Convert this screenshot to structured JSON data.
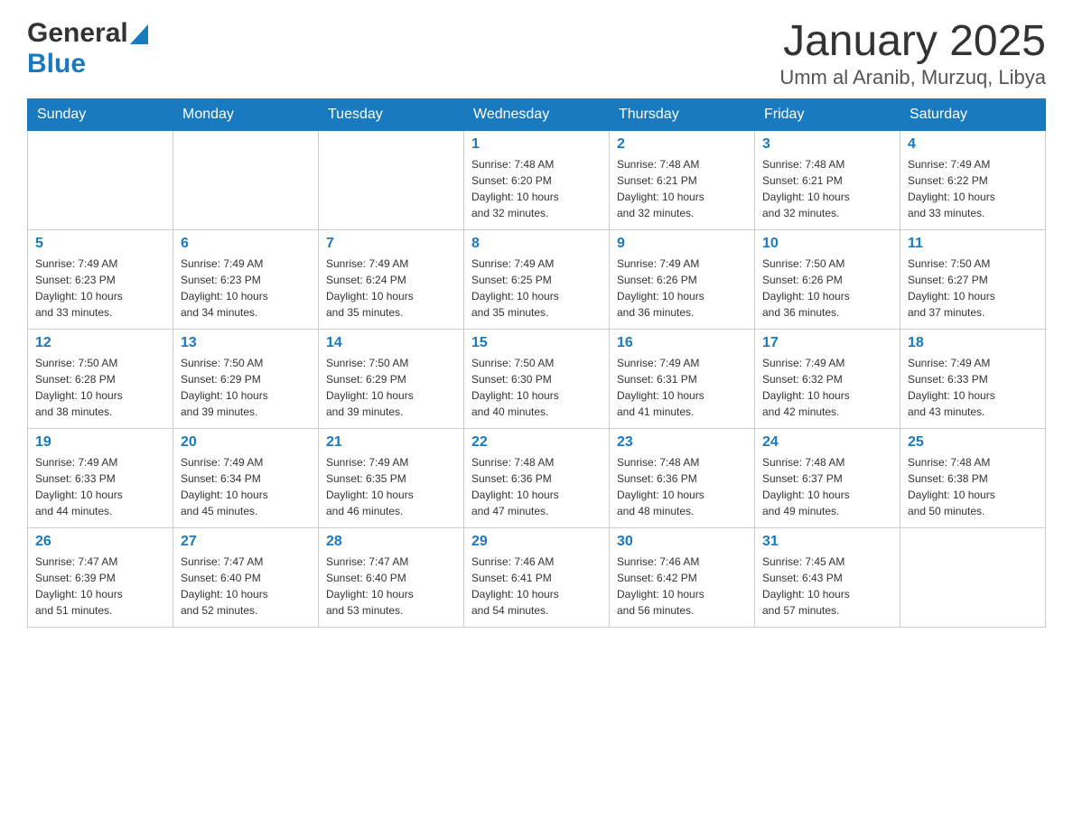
{
  "header": {
    "logo_general": "General",
    "logo_blue": "Blue",
    "month_title": "January 2025",
    "location": "Umm al Aranib, Murzuq, Libya"
  },
  "days_of_week": [
    "Sunday",
    "Monday",
    "Tuesday",
    "Wednesday",
    "Thursday",
    "Friday",
    "Saturday"
  ],
  "weeks": [
    [
      {
        "day": "",
        "info": ""
      },
      {
        "day": "",
        "info": ""
      },
      {
        "day": "",
        "info": ""
      },
      {
        "day": "1",
        "info": "Sunrise: 7:48 AM\nSunset: 6:20 PM\nDaylight: 10 hours\nand 32 minutes."
      },
      {
        "day": "2",
        "info": "Sunrise: 7:48 AM\nSunset: 6:21 PM\nDaylight: 10 hours\nand 32 minutes."
      },
      {
        "day": "3",
        "info": "Sunrise: 7:48 AM\nSunset: 6:21 PM\nDaylight: 10 hours\nand 32 minutes."
      },
      {
        "day": "4",
        "info": "Sunrise: 7:49 AM\nSunset: 6:22 PM\nDaylight: 10 hours\nand 33 minutes."
      }
    ],
    [
      {
        "day": "5",
        "info": "Sunrise: 7:49 AM\nSunset: 6:23 PM\nDaylight: 10 hours\nand 33 minutes."
      },
      {
        "day": "6",
        "info": "Sunrise: 7:49 AM\nSunset: 6:23 PM\nDaylight: 10 hours\nand 34 minutes."
      },
      {
        "day": "7",
        "info": "Sunrise: 7:49 AM\nSunset: 6:24 PM\nDaylight: 10 hours\nand 35 minutes."
      },
      {
        "day": "8",
        "info": "Sunrise: 7:49 AM\nSunset: 6:25 PM\nDaylight: 10 hours\nand 35 minutes."
      },
      {
        "day": "9",
        "info": "Sunrise: 7:49 AM\nSunset: 6:26 PM\nDaylight: 10 hours\nand 36 minutes."
      },
      {
        "day": "10",
        "info": "Sunrise: 7:50 AM\nSunset: 6:26 PM\nDaylight: 10 hours\nand 36 minutes."
      },
      {
        "day": "11",
        "info": "Sunrise: 7:50 AM\nSunset: 6:27 PM\nDaylight: 10 hours\nand 37 minutes."
      }
    ],
    [
      {
        "day": "12",
        "info": "Sunrise: 7:50 AM\nSunset: 6:28 PM\nDaylight: 10 hours\nand 38 minutes."
      },
      {
        "day": "13",
        "info": "Sunrise: 7:50 AM\nSunset: 6:29 PM\nDaylight: 10 hours\nand 39 minutes."
      },
      {
        "day": "14",
        "info": "Sunrise: 7:50 AM\nSunset: 6:29 PM\nDaylight: 10 hours\nand 39 minutes."
      },
      {
        "day": "15",
        "info": "Sunrise: 7:50 AM\nSunset: 6:30 PM\nDaylight: 10 hours\nand 40 minutes."
      },
      {
        "day": "16",
        "info": "Sunrise: 7:49 AM\nSunset: 6:31 PM\nDaylight: 10 hours\nand 41 minutes."
      },
      {
        "day": "17",
        "info": "Sunrise: 7:49 AM\nSunset: 6:32 PM\nDaylight: 10 hours\nand 42 minutes."
      },
      {
        "day": "18",
        "info": "Sunrise: 7:49 AM\nSunset: 6:33 PM\nDaylight: 10 hours\nand 43 minutes."
      }
    ],
    [
      {
        "day": "19",
        "info": "Sunrise: 7:49 AM\nSunset: 6:33 PM\nDaylight: 10 hours\nand 44 minutes."
      },
      {
        "day": "20",
        "info": "Sunrise: 7:49 AM\nSunset: 6:34 PM\nDaylight: 10 hours\nand 45 minutes."
      },
      {
        "day": "21",
        "info": "Sunrise: 7:49 AM\nSunset: 6:35 PM\nDaylight: 10 hours\nand 46 minutes."
      },
      {
        "day": "22",
        "info": "Sunrise: 7:48 AM\nSunset: 6:36 PM\nDaylight: 10 hours\nand 47 minutes."
      },
      {
        "day": "23",
        "info": "Sunrise: 7:48 AM\nSunset: 6:36 PM\nDaylight: 10 hours\nand 48 minutes."
      },
      {
        "day": "24",
        "info": "Sunrise: 7:48 AM\nSunset: 6:37 PM\nDaylight: 10 hours\nand 49 minutes."
      },
      {
        "day": "25",
        "info": "Sunrise: 7:48 AM\nSunset: 6:38 PM\nDaylight: 10 hours\nand 50 minutes."
      }
    ],
    [
      {
        "day": "26",
        "info": "Sunrise: 7:47 AM\nSunset: 6:39 PM\nDaylight: 10 hours\nand 51 minutes."
      },
      {
        "day": "27",
        "info": "Sunrise: 7:47 AM\nSunset: 6:40 PM\nDaylight: 10 hours\nand 52 minutes."
      },
      {
        "day": "28",
        "info": "Sunrise: 7:47 AM\nSunset: 6:40 PM\nDaylight: 10 hours\nand 53 minutes."
      },
      {
        "day": "29",
        "info": "Sunrise: 7:46 AM\nSunset: 6:41 PM\nDaylight: 10 hours\nand 54 minutes."
      },
      {
        "day": "30",
        "info": "Sunrise: 7:46 AM\nSunset: 6:42 PM\nDaylight: 10 hours\nand 56 minutes."
      },
      {
        "day": "31",
        "info": "Sunrise: 7:45 AM\nSunset: 6:43 PM\nDaylight: 10 hours\nand 57 minutes."
      },
      {
        "day": "",
        "info": ""
      }
    ]
  ]
}
